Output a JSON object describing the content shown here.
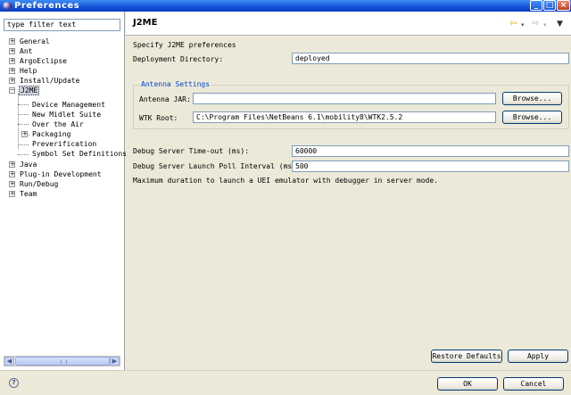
{
  "window": {
    "title": "Preferences"
  },
  "filter": {
    "value": "type filter text"
  },
  "tree": {
    "items": [
      {
        "label": "General"
      },
      {
        "label": "Ant"
      },
      {
        "label": "ArgoEclipse"
      },
      {
        "label": "Help"
      },
      {
        "label": "Install/Update"
      },
      {
        "label": "J2ME"
      },
      {
        "label": "Device Management"
      },
      {
        "label": "New Midlet Suite"
      },
      {
        "label": "Over the Air"
      },
      {
        "label": "Packaging"
      },
      {
        "label": "Preverification"
      },
      {
        "label": "Symbol Set Definitions"
      },
      {
        "label": "Java"
      },
      {
        "label": "Plug-in Development"
      },
      {
        "label": "Run/Debug"
      },
      {
        "label": "Team"
      }
    ]
  },
  "page": {
    "title": "J2ME",
    "description": "Specify J2ME preferences",
    "deployment_label": "Deployment Directory:",
    "deployment_value": "deployed",
    "antenna_group": "Antenna Settings",
    "antenna_jar_label": "Antenna JAR:",
    "antenna_jar_value": "",
    "wtk_root_label": "WTK Root:",
    "wtk_root_value": "C:\\Program Files\\NetBeans 6.1\\mobility8\\WTK2.5.2",
    "browse_label": "Browse...",
    "timeout_label": "Debug Server Time-out (ms):",
    "timeout_value": "60000",
    "poll_label": "Debug Server Launch Poll Interval (ms)",
    "poll_value": "500",
    "note": "Maximum duration to launch a UEI emulator with debugger in server mode."
  },
  "buttons": {
    "restore_defaults": "Restore Defaults",
    "apply": "Apply",
    "ok": "OK",
    "cancel": "Cancel"
  },
  "icons": {
    "back": "back-arrow-icon",
    "forward": "forward-arrow-icon",
    "menu": "view-menu-icon",
    "help": "help-icon"
  },
  "colors": {
    "titlebar": "#1452d6",
    "group_legend": "#0046d5",
    "selection": "#cfd5e2"
  }
}
